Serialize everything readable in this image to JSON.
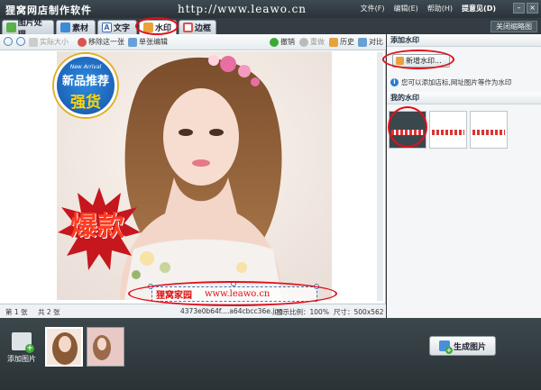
{
  "app": {
    "title": "狸窝网店制作软件",
    "watermark_text": "http://www.leawo.cn"
  },
  "menu": {
    "file": "文件(F)",
    "edit": "编辑(E)",
    "help": "帮助(H)",
    "feedback": "提意见(D)"
  },
  "tabs": [
    {
      "label": "图片处理"
    },
    {
      "label": "素材"
    },
    {
      "label": "文字"
    },
    {
      "label": "水印"
    },
    {
      "label": "边框"
    }
  ],
  "close_thumbnails": "关闭缩略图",
  "toolbar": {
    "actual_size": "实际大小",
    "remove_watermark": "移除这一张",
    "single_edit": "单张编辑",
    "undo": "撤销",
    "redo": "重做",
    "history": "历史",
    "compare": "对比"
  },
  "canvas": {
    "badge_top_small": "New Arrival",
    "badge_top_main": "新品推荐",
    "badge_bottom": "强货",
    "burst_text": "爆款",
    "watermark_left": "狸窝家园",
    "watermark_right": "www.leawo.cn"
  },
  "status": {
    "current": "第 1 张",
    "total": "共 2 张",
    "filename": "4373e0b64f....a64cbcc36e.jpg",
    "scale": "显示比例：100%",
    "size": "尺寸：500x562"
  },
  "right_panel": {
    "add_header": "添加水印",
    "new_button": "新增水印...",
    "info": "您可以添加店标,网址图片等作为水印",
    "my_header": "我的水印"
  },
  "bottom": {
    "add_image": "添加图片",
    "generate": "生成图片"
  }
}
